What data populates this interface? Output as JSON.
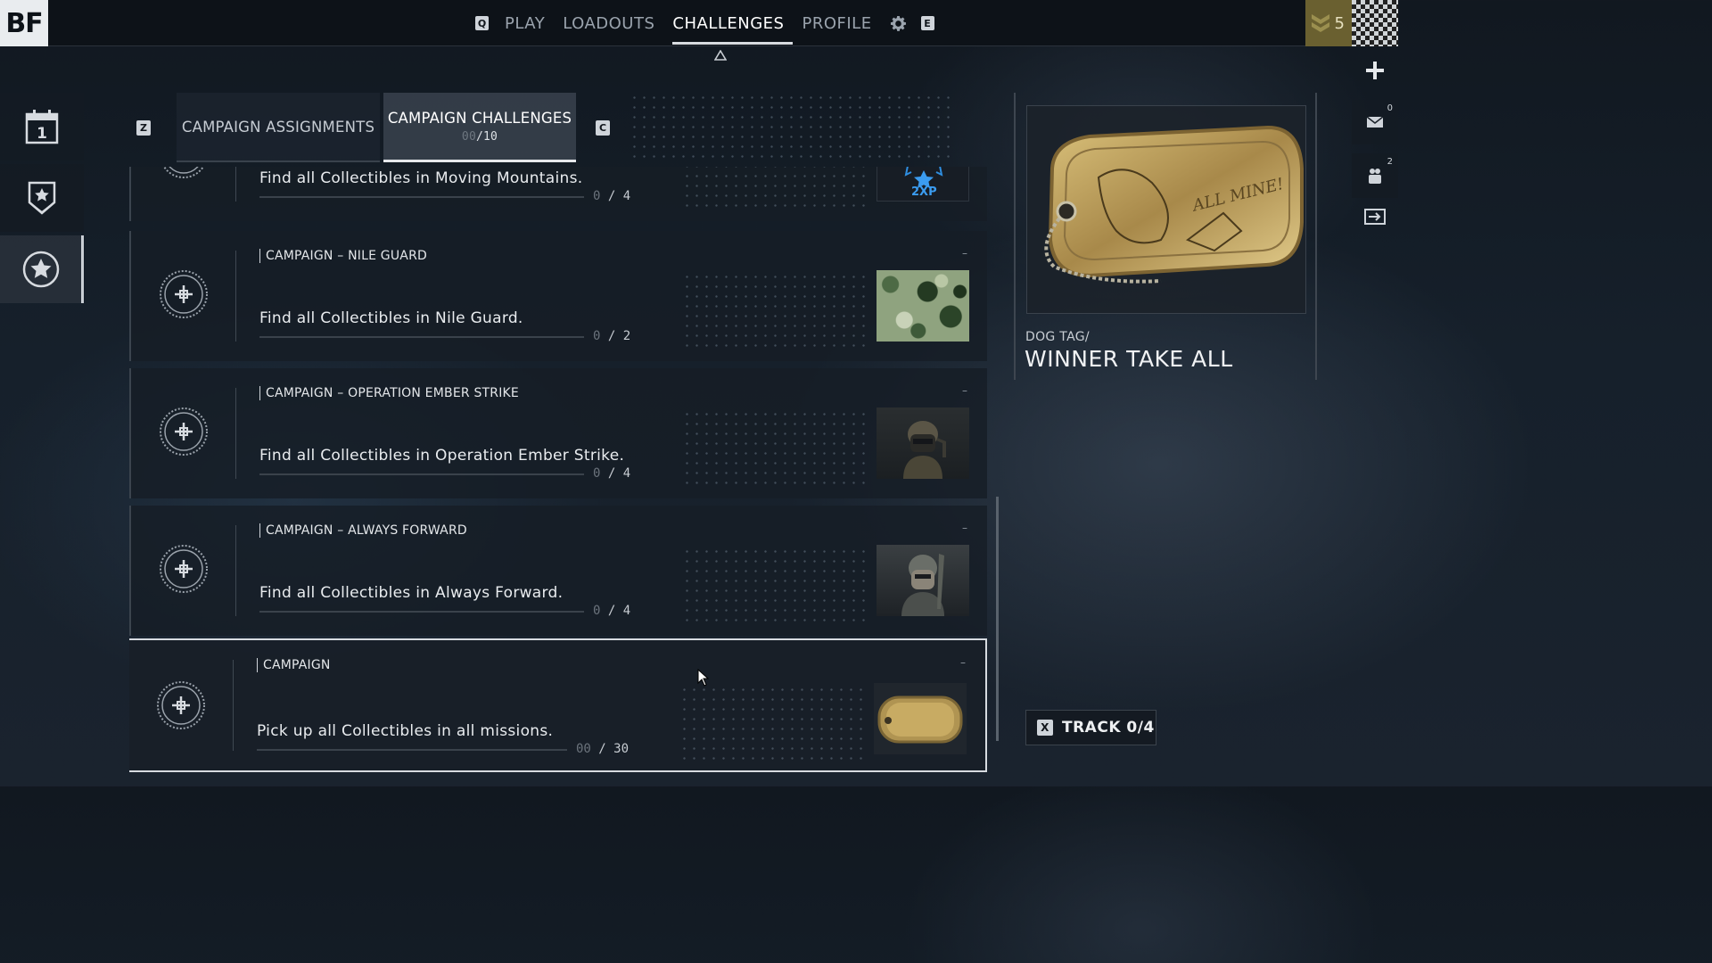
{
  "app": {
    "logo": "BF"
  },
  "nav": {
    "left_key": "Q",
    "items": [
      {
        "label": "PLAY"
      },
      {
        "label": "LOADOUTS"
      },
      {
        "label": "CHALLENGES"
      },
      {
        "label": "PROFILE"
      }
    ],
    "right_key": "E",
    "active": "CHALLENGES"
  },
  "player": {
    "rank": "5"
  },
  "right_rail": {
    "mail_count": "0",
    "squad_count": "2"
  },
  "subtabs": {
    "left_key": "Z",
    "right_key": "C",
    "assignments": "CAMPAIGN ASSIGNMENTS",
    "challenges": "CAMPAIGN CHALLENGES",
    "challenges_progress_done": "00",
    "challenges_progress_total": "/10"
  },
  "challenges": [
    {
      "category": "",
      "description": "Find all Collectibles in Moving Mountains.",
      "progress": "0",
      "total": "/ 4",
      "reward": "2XP"
    },
    {
      "category": "CAMPAIGN – NILE GUARD",
      "description": "Find all Collectibles in Nile Guard.",
      "progress": "0",
      "total": "/ 2",
      "dash": "–"
    },
    {
      "category": "CAMPAIGN – OPERATION EMBER STRIKE",
      "description": "Find all Collectibles in Operation Ember Strike.",
      "progress": "0",
      "total": "/ 4",
      "dash": "–"
    },
    {
      "category": "CAMPAIGN – ALWAYS FORWARD",
      "description": "Find all Collectibles in Always Forward.",
      "progress": "0",
      "total": "/ 4",
      "dash": "–"
    },
    {
      "category": "CAMPAIGN",
      "description": "Pick up all Collectibles in all missions.",
      "progress": "00",
      "total": "/ 30",
      "dash": "–"
    }
  ],
  "reward_panel": {
    "type_label": "DOG TAG/",
    "name": "WINNER TAKE ALL",
    "tag_text": "ALL MINE!"
  },
  "track": {
    "key": "X",
    "label": "TRACK 0/4"
  },
  "colors": {
    "accent": "#d7dbe0",
    "rank_bg": "#6a6030",
    "background": "#16202b"
  }
}
